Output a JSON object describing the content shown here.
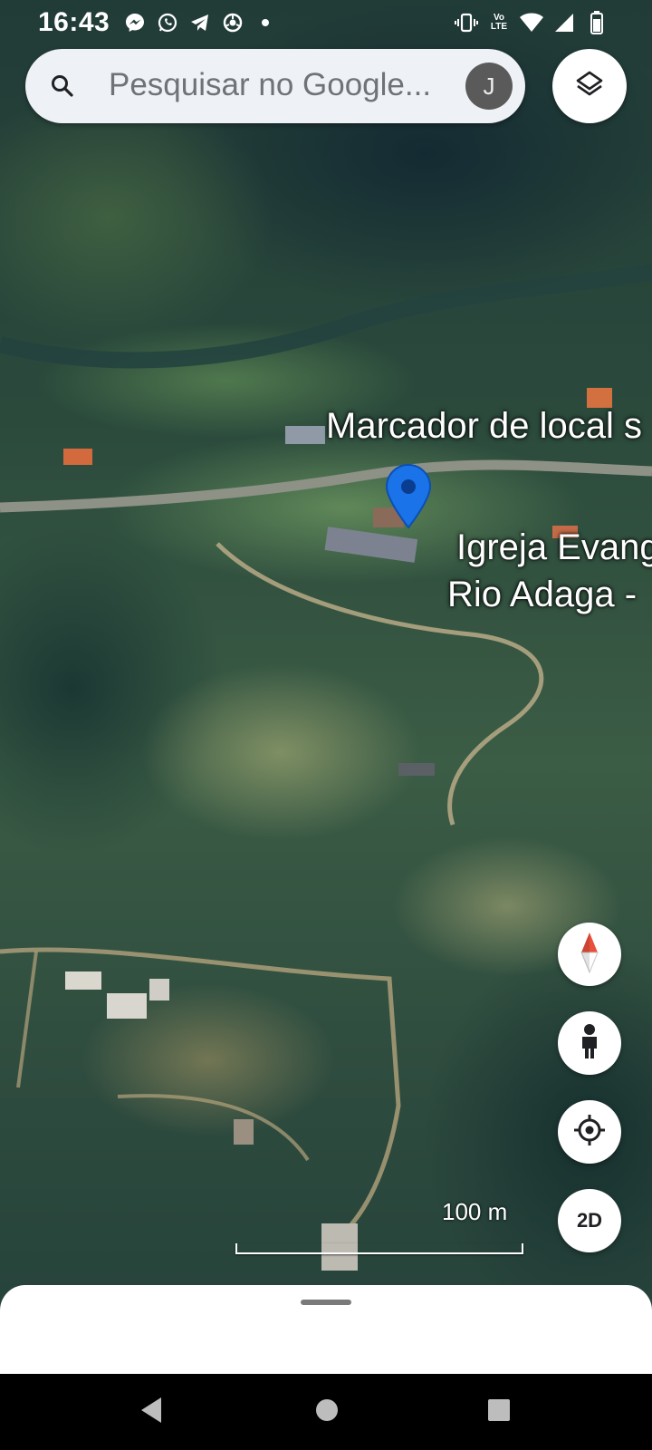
{
  "status_bar": {
    "time": "16:43",
    "left_icons": [
      "messenger-icon",
      "whatsapp-icon",
      "telegram-icon",
      "chrome-icon",
      "dot-icon"
    ],
    "right_icons": [
      "vibrate-icon",
      "volte-icon",
      "wifi-icon",
      "signal-icon",
      "battery-icon"
    ],
    "volte_text": "Vo LTE"
  },
  "search": {
    "placeholder": "Pesquisar no Google...",
    "avatar_initial": "J"
  },
  "map": {
    "labels": {
      "marker_label": "Marcador de local s",
      "church_line1": "Igreja Evang",
      "church_line2": "Rio Adaga -"
    },
    "scale": "100 m",
    "pin_color": "#1a73e8"
  },
  "controls": {
    "layers": "layers-icon",
    "compass": "compass-icon",
    "street_view": "pegman-icon",
    "my_location": "my-location-icon",
    "view_mode": "2D"
  },
  "nav_bar": {
    "buttons": [
      "back-icon",
      "home-icon",
      "recents-icon"
    ]
  }
}
